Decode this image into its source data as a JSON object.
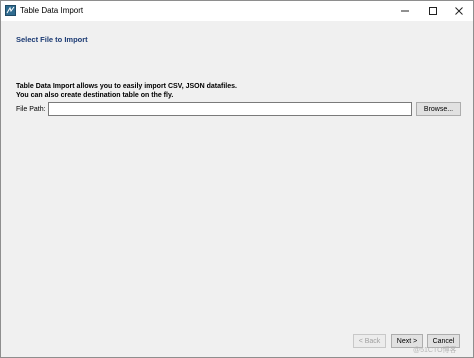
{
  "window": {
    "title": "Table Data Import",
    "icon": "mysql-workbench-icon"
  },
  "page": {
    "title": "Select File to Import",
    "description_line1": "Table Data Import allows you to easily import CSV, JSON datafiles.",
    "description_line2": "You can also create destination table on the fly."
  },
  "file_path": {
    "label": "File Path:",
    "value": "",
    "browse_label": "Browse..."
  },
  "footer": {
    "back_label": "< Back",
    "next_label": "Next >",
    "cancel_label": "Cancel"
  },
  "watermark": "@51CTO博客",
  "colors": {
    "title_accent": "#1b3a73",
    "background": "#f0f0f0"
  }
}
